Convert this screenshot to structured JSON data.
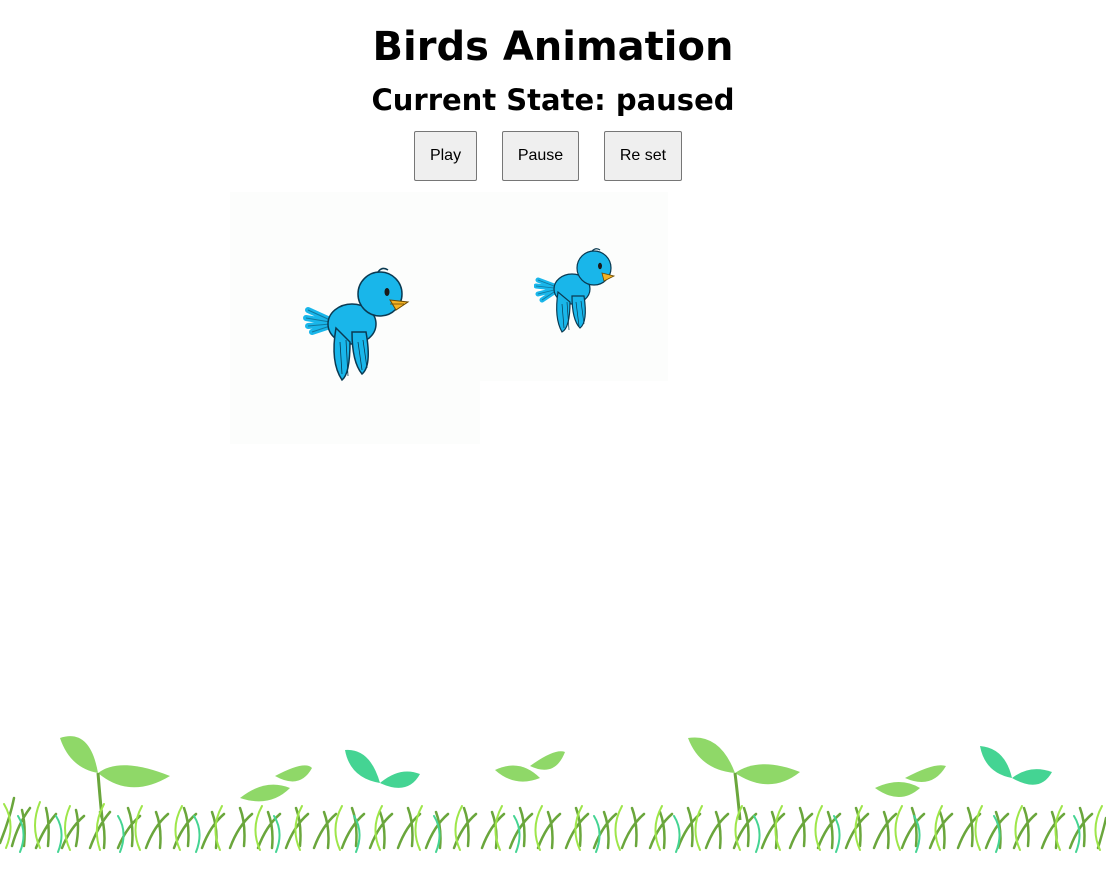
{
  "header": {
    "title": "Birds Animation",
    "state_label": "Current State: paused"
  },
  "controls": {
    "play_label": "Play",
    "pause_label": "Pause",
    "reset_label": "Re set"
  },
  "scene": {
    "birds": [
      {
        "icon": "bird-icon",
        "color": "#19b6ea"
      },
      {
        "icon": "bird-icon",
        "color": "#19b6ea"
      }
    ],
    "ground_icon": "grass-icon",
    "colors": {
      "bird_body": "#19b6ea",
      "bird_beak": "#f5b324",
      "leaf_green": "#8fd868",
      "leaf_teal": "#44d493",
      "grass_dark": "#6aa63c"
    }
  }
}
